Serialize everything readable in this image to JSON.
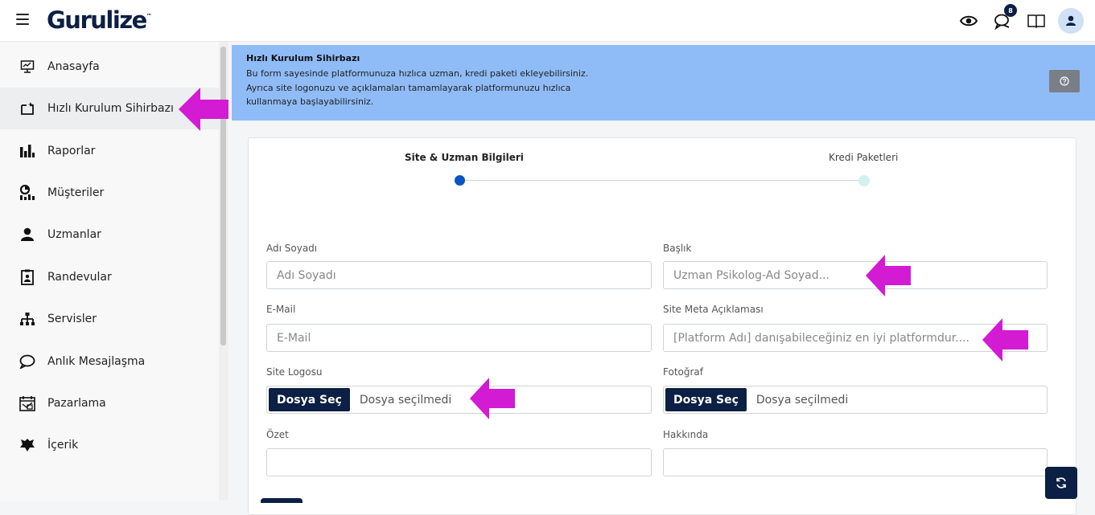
{
  "brand": {
    "name": "Gurulize",
    "tm": "™"
  },
  "header": {
    "notifications_count": "8",
    "icons": [
      "eye-icon",
      "chat-icon",
      "book-icon",
      "user-icon"
    ]
  },
  "sidebar": {
    "items": [
      {
        "label": "Anasayfa",
        "icon": "presentation-icon"
      },
      {
        "label": "Hızlı Kurulum Sihirbazı",
        "icon": "setup-icon",
        "active": true
      },
      {
        "label": "Raporlar",
        "icon": "bar-chart-icon"
      },
      {
        "label": "Müşteriler",
        "icon": "customers-icon"
      },
      {
        "label": "Uzmanlar",
        "icon": "experts-icon"
      },
      {
        "label": "Randevular",
        "icon": "appointment-icon"
      },
      {
        "label": "Servisler",
        "icon": "hierarchy-icon"
      },
      {
        "label": "Anlık Mesajlaşma",
        "icon": "message-icon"
      },
      {
        "label": "Pazarlama",
        "icon": "marketing-icon"
      },
      {
        "label": "İçerik",
        "icon": "content-icon"
      }
    ]
  },
  "banner": {
    "title": "Hızlı Kurulum Sihirbazı",
    "line1": "Bu form sayesinde platformunuza hızlıca uzman, kredi paketi ekleyebilirsiniz.",
    "line2": "Ayrıca site logonuzu ve açıklamaları tamamlayarak platformunuzu hızlıca",
    "line3": "kullanmaya başlayabilirsiniz."
  },
  "steps": {
    "step1": "Site & Uzman Bilgileri",
    "step2": "Kredi Paketleri"
  },
  "form": {
    "name_label": "Adı Soyadı",
    "name_placeholder": "Adı Soyadı",
    "title_label": "Başlık",
    "title_placeholder": "Uzman Psikolog-Ad Soyad...",
    "email_label": "E-Mail",
    "email_placeholder": "E-Mail",
    "meta_label": "Site Meta Açıklaması",
    "meta_placeholder": "[Platform Adı] danışabileceğiniz en iyi platformdur....",
    "logo_label": "Site Logosu",
    "photo_label": "Fotoğraf",
    "file_button": "Dosya Seç",
    "file_none": "Dosya seçilmedi",
    "summary_label": "Özet",
    "about_label": "Hakkında"
  },
  "colors": {
    "accent": "#0c1f44",
    "banner": "#8fbcf7",
    "arrow": "#d21bd2",
    "step_active": "#0a56c2"
  }
}
